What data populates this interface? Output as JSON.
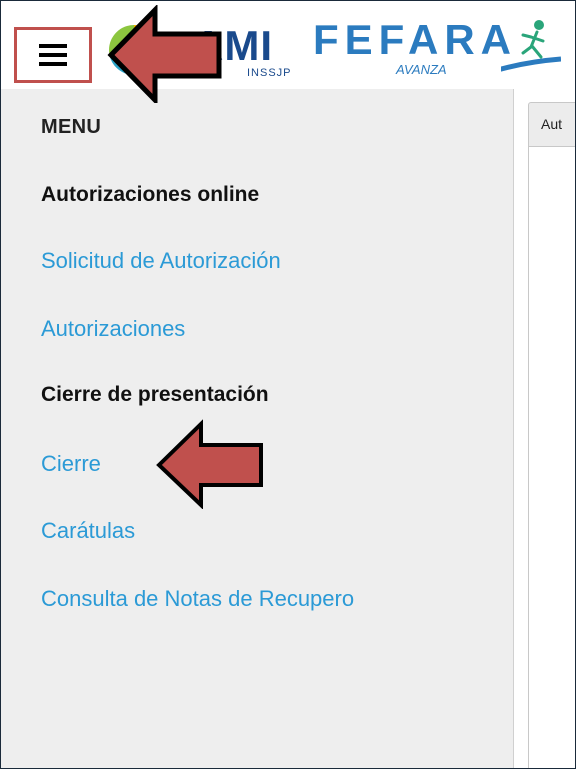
{
  "header": {
    "logo_pami": {
      "main": "AMI",
      "sub": "INSSJP"
    },
    "logo_fefara": {
      "main": "FEFARA",
      "sub": "AVANZA"
    }
  },
  "sidebar": {
    "title": "MENU",
    "sections": [
      {
        "title": "Autorizaciones online",
        "items": [
          {
            "label": "Solicitud de Autorización"
          },
          {
            "label": "Autorizaciones"
          }
        ]
      },
      {
        "title": "Cierre de presentación",
        "items": [
          {
            "label": "Cierre"
          },
          {
            "label": "Carátulas"
          },
          {
            "label": "Consulta de Notas de Recupero"
          }
        ]
      }
    ]
  },
  "content": {
    "tab_label": "Aut"
  },
  "colors": {
    "highlight_border": "#c0504d",
    "arrow_fill": "#c0504d",
    "link": "#2b9ad6",
    "sidebar_bg": "#eeeeee"
  }
}
